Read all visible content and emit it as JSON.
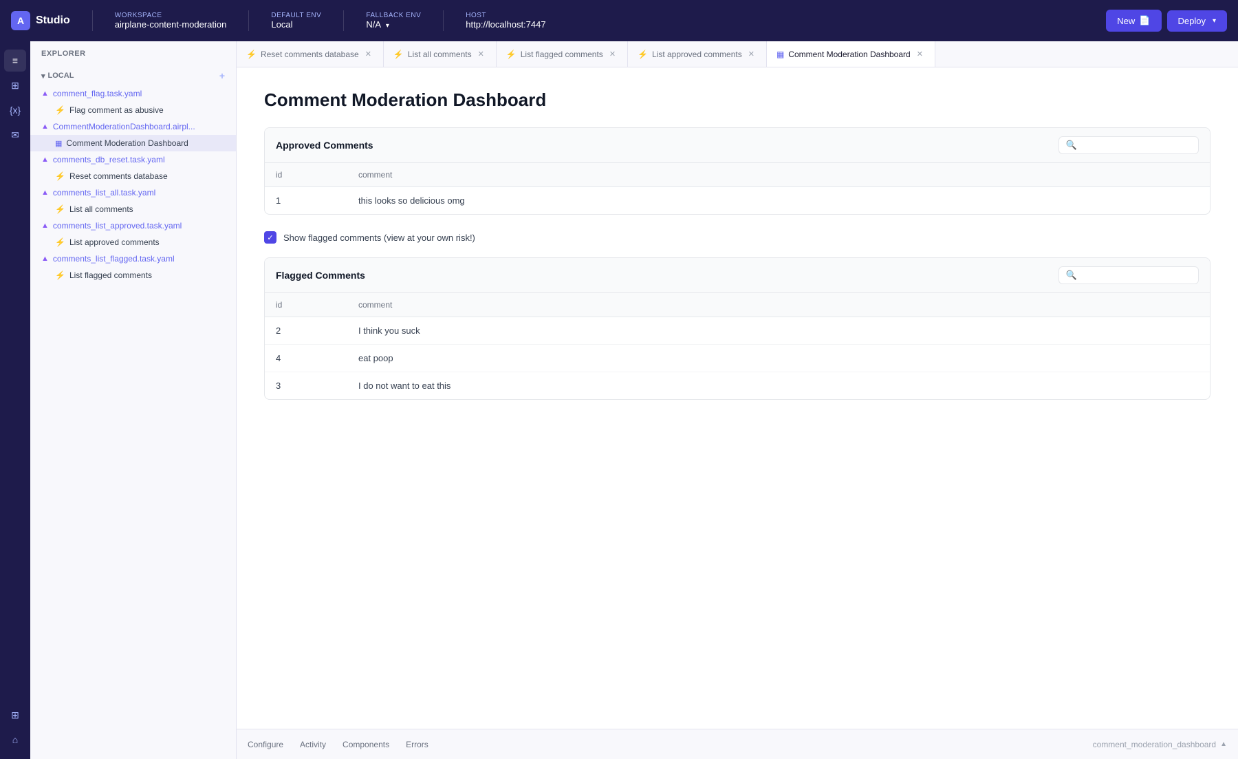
{
  "app": {
    "name": "Studio"
  },
  "navbar": {
    "workspace_label": "WORKSPACE",
    "workspace_value": "airplane-content-moderation",
    "default_env_label": "DEFAULT ENV",
    "default_env_value": "Local",
    "fallback_env_label": "FALLBACK ENV",
    "fallback_env_value": "N/A",
    "host_label": "HOST",
    "host_value": "http://localhost:7447",
    "btn_new": "New",
    "btn_deploy": "Deploy"
  },
  "sidebar": {
    "header": "EXPLORER",
    "section": "LOCAL",
    "items": [
      {
        "id": "comment-flag-file",
        "icon": "file",
        "label": "comment_flag.task.yaml",
        "type": "file"
      },
      {
        "id": "flag-comment-sub",
        "icon": "bolt",
        "label": "Flag comment as abusive",
        "type": "sub"
      },
      {
        "id": "comment-mod-file",
        "icon": "file",
        "label": "CommentModerationDashboard.airpl...",
        "type": "file"
      },
      {
        "id": "comment-mod-dash",
        "icon": "dashboard",
        "label": "Comment Moderation Dashboard",
        "type": "sub-active"
      },
      {
        "id": "comments-db-reset-file",
        "icon": "file",
        "label": "comments_db_reset.task.yaml",
        "type": "file"
      },
      {
        "id": "reset-comments-sub",
        "icon": "bolt",
        "label": "Reset comments database",
        "type": "sub"
      },
      {
        "id": "comments-list-all-file",
        "icon": "file",
        "label": "comments_list_all.task.yaml",
        "type": "file"
      },
      {
        "id": "list-all-sub",
        "icon": "bolt",
        "label": "List all comments",
        "type": "sub"
      },
      {
        "id": "comments-list-approved-file",
        "icon": "file",
        "label": "comments_list_approved.task.yaml",
        "type": "file"
      },
      {
        "id": "list-approved-sub",
        "icon": "bolt",
        "label": "List approved comments",
        "type": "sub"
      },
      {
        "id": "comments-list-flagged-file",
        "icon": "file",
        "label": "comments_list_flagged.task.yaml",
        "type": "file"
      },
      {
        "id": "list-flagged-sub",
        "icon": "bolt",
        "label": "List flagged comments",
        "type": "sub"
      }
    ]
  },
  "tabs": [
    {
      "id": "tab-reset",
      "icon": "bolt",
      "label": "Reset comments database",
      "closable": true
    },
    {
      "id": "tab-list-all",
      "icon": "bolt",
      "label": "List all comments",
      "closable": true
    },
    {
      "id": "tab-list-flagged",
      "icon": "bolt",
      "label": "List flagged comments",
      "closable": true
    },
    {
      "id": "tab-list-approved",
      "icon": "bolt",
      "label": "List approved comments",
      "closable": true
    },
    {
      "id": "tab-dashboard",
      "icon": "dashboard",
      "label": "Comment Moderation Dashboard",
      "closable": true,
      "active": true
    }
  ],
  "page": {
    "title": "Comment Moderation Dashboard",
    "approved_table": {
      "title": "Approved Comments",
      "columns": [
        "id",
        "comment"
      ],
      "rows": [
        {
          "id": "1",
          "comment": "this looks so delicious omg"
        }
      ]
    },
    "checkbox": {
      "label": "Show flagged comments (view at your own risk!)",
      "checked": true
    },
    "flagged_table": {
      "title": "Flagged Comments",
      "columns": [
        "id",
        "comment"
      ],
      "rows": [
        {
          "id": "2",
          "comment": "I think you suck"
        },
        {
          "id": "4",
          "comment": "eat poop"
        },
        {
          "id": "3",
          "comment": "I do not want to eat this"
        }
      ]
    }
  },
  "bottom_bar": {
    "tabs": [
      "Configure",
      "Activity",
      "Components",
      "Errors"
    ],
    "id_label": "comment_moderation_dashboard"
  }
}
